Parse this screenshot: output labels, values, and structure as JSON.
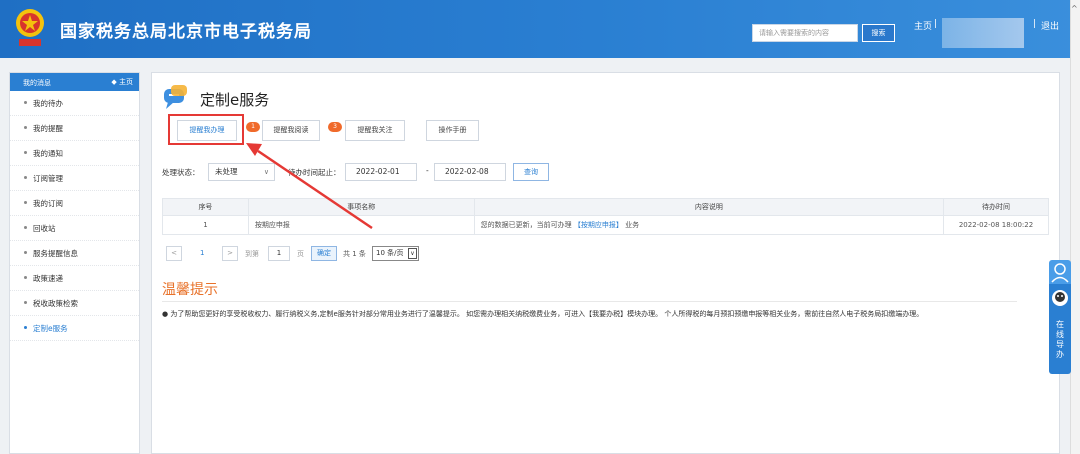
{
  "header": {
    "title": "国家税务总局北京市电子税务局",
    "search_placeholder": "请输入需要搜索的内容",
    "search_button": "搜索",
    "home_link": "主页",
    "separator": "|",
    "logout": "退出"
  },
  "sidebar": {
    "title": "我的消息",
    "home": "◆ 主页",
    "items": [
      {
        "label": "我的待办"
      },
      {
        "label": "我的提醒"
      },
      {
        "label": "我的通知"
      },
      {
        "label": "订阅管理"
      },
      {
        "label": "我的订阅"
      },
      {
        "label": "回收站"
      },
      {
        "label": "服务提醒信息"
      },
      {
        "label": "政策速递"
      },
      {
        "label": "税收政策检索"
      },
      {
        "label": "定制e服务"
      }
    ]
  },
  "main": {
    "title": "定制e服务",
    "tabs": [
      {
        "label": "提醒我办理",
        "badge": "1"
      },
      {
        "label": "提醒我阅读",
        "badge": "3"
      },
      {
        "label": "提醒我关注"
      },
      {
        "label": "操作手册"
      }
    ],
    "filter": {
      "status_label": "处理状态：",
      "status_value": "未处理",
      "date_label": "待办时间起止：",
      "date_from": "2022-02-01",
      "date_dash": "-",
      "date_to": "2022-02-08",
      "query_button": "查询"
    },
    "table": {
      "headers": [
        "序号",
        "事项名称",
        "内容说明",
        "待办时间"
      ],
      "rows": [
        {
          "no": "1",
          "name": "按期应申报",
          "desc_prefix": "您的数据已更新，当前可办理",
          "desc_link": "【按期应申报】",
          "desc_suffix": "业务",
          "time": "2022-02-08 18:00:22"
        }
      ]
    },
    "pager": {
      "prev": "<",
      "page": "1",
      "next": ">",
      "goto": "到第",
      "goto_value": "1",
      "page_unit": "页",
      "ok": "确定",
      "total": "共 1 条",
      "size": "10 条/页"
    },
    "tips": {
      "title": "温馨提示",
      "text": "● 为了帮助您更好的享受税收权力、履行纳税义务,定制e服务针对部分常用业务进行了温馨提示。 如您需办理相关纳税缴费业务，可进入【我要办税】模块办理。 个人所得税的每月预扣预缴申报等相关业务，需前往自然人电子税务局扣缴端办理。"
    }
  },
  "float_widget": {
    "text": "在线导办"
  },
  "colors": {
    "header_blue": "#2a7fd2",
    "highlight_red": "#e53935",
    "badge_orange": "#f06a2b",
    "tips_orange": "#e8722a"
  }
}
